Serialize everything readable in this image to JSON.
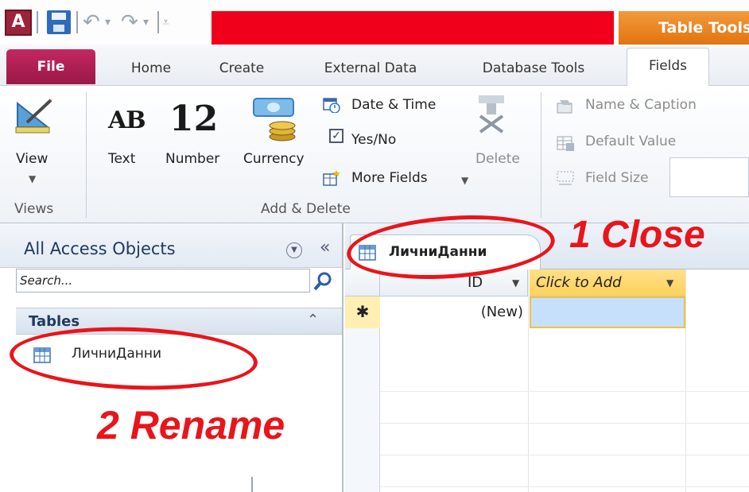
{
  "titlebar": {
    "app_logo": "A",
    "context_tab": "Table Tools"
  },
  "tabs": [
    {
      "label": "File"
    },
    {
      "label": "Home"
    },
    {
      "label": "Create"
    },
    {
      "label": "External Data"
    },
    {
      "label": "Database Tools"
    },
    {
      "label": "Fields"
    }
  ],
  "ribbon": {
    "views": {
      "view_label": "View",
      "group_label": "Views"
    },
    "add_delete": {
      "text_glyph": "AB",
      "text_label": "Text",
      "number_glyph": "12",
      "number_label": "Number",
      "currency_label": "Currency",
      "date_time": "Date & Time",
      "yes_no": "Yes/No",
      "more_fields": "More Fields",
      "delete": "Delete",
      "group_label": "Add & Delete"
    },
    "properties": {
      "name_caption": "Name & Caption",
      "default_value": "Default Value",
      "field_size": "Field Size"
    }
  },
  "nav": {
    "title": "All Access Objects",
    "collapse": "«",
    "search_placeholder": "Search...",
    "section": "Tables",
    "section_chevron": "⌃",
    "items": [
      {
        "label": "ЛичниДанни"
      }
    ]
  },
  "document": {
    "tab_label": "ЛичниДанни",
    "columns": [
      {
        "label": "ID"
      },
      {
        "label": "Click to Add"
      }
    ],
    "new_row_marker": "✱",
    "new_row_id": "(New)"
  },
  "annotations": {
    "close": "1 Close",
    "rename": "2 Rename"
  },
  "colors": {
    "annotation": "#e8151b",
    "file_tab": "#b02058",
    "context_tab": "#ec8a25",
    "title_bar_highlight": "#f0001b",
    "click_to_add_header": "#ffd966",
    "selected_cell": "#c6e0fb"
  }
}
